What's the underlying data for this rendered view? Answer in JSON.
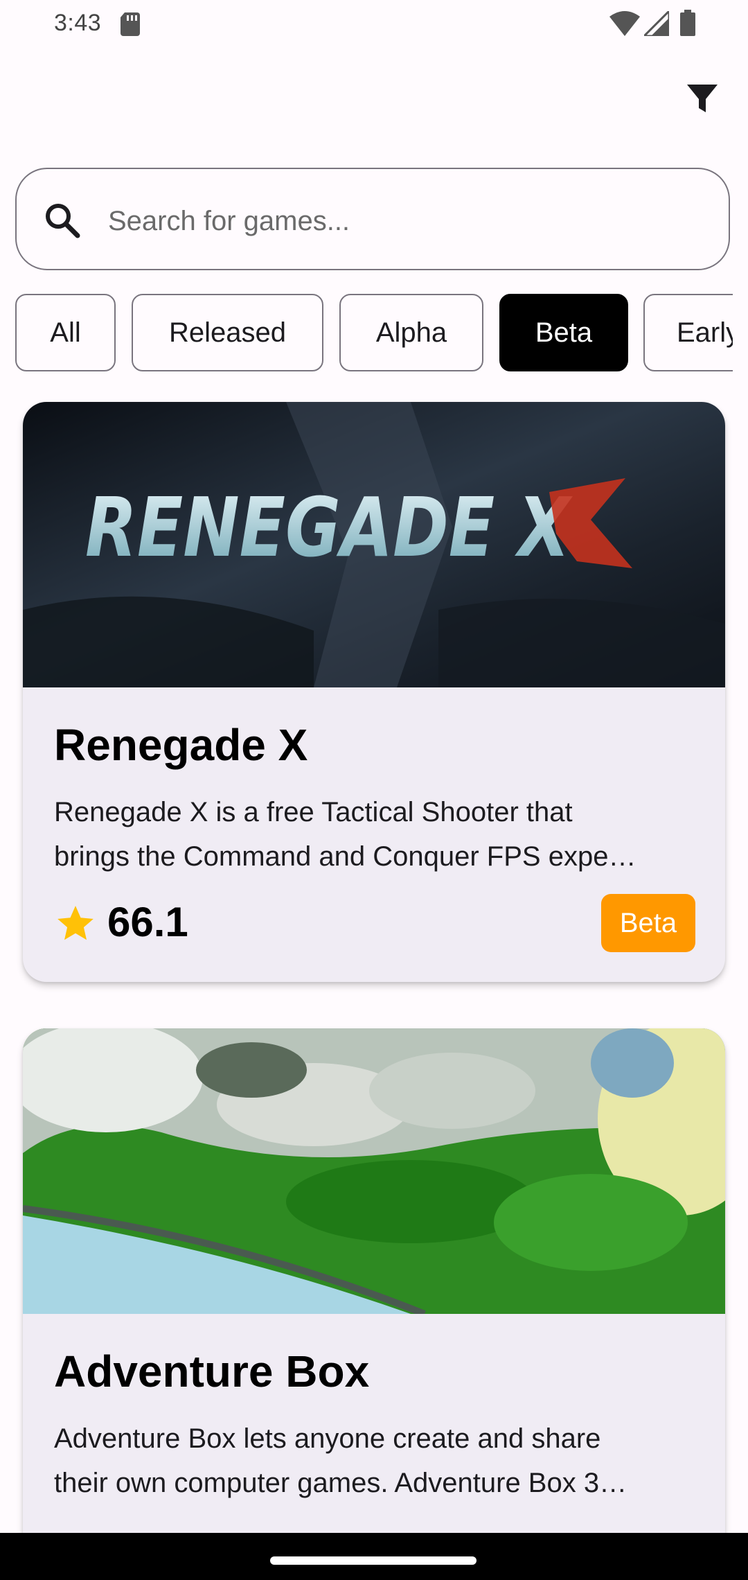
{
  "status_bar": {
    "time": "3:43",
    "icons": [
      "sd-card-icon",
      "wifi-icon",
      "signal-icon",
      "battery-icon"
    ]
  },
  "toolbar": {
    "filter_icon": "filter-icon"
  },
  "search": {
    "placeholder": "Search for games...",
    "value": "",
    "icon": "search-icon"
  },
  "filters": {
    "chips": [
      {
        "label": "All",
        "selected": false
      },
      {
        "label": "Released",
        "selected": false
      },
      {
        "label": "Alpha",
        "selected": false
      },
      {
        "label": "Beta",
        "selected": true
      },
      {
        "label": "Early",
        "selected": false
      }
    ]
  },
  "games": [
    {
      "title": "Renegade X",
      "description_line1": "Renegade X is a free Tactical Shooter that",
      "description_line2": "brings the Command and Conquer FPS expe…",
      "rating": "66.1",
      "status": "Beta",
      "image_logo_text": "RENEGADE X"
    },
    {
      "title": "Adventure Box",
      "description_line1": "Adventure Box lets anyone create and share",
      "description_line2": "their own computer games. Adventure Box 3…"
    }
  ],
  "colors": {
    "accent_badge": "#ff9800",
    "star": "#ffc107",
    "selected_chip": "#000000",
    "card_bg": "#f0ecf4",
    "background": "#fffbfe"
  }
}
